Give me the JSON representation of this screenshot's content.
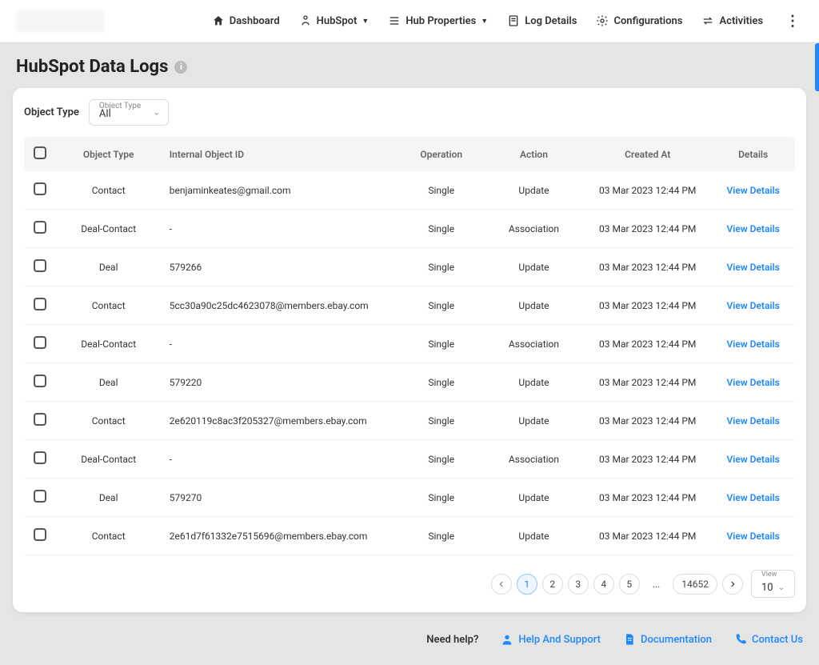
{
  "nav": {
    "dashboard": "Dashboard",
    "hubspot": "HubSpot",
    "hub_properties": "Hub Properties",
    "log_details": "Log Details",
    "configurations": "Configurations",
    "activities": "Activities"
  },
  "page_title": "HubSpot Data Logs",
  "filter": {
    "label": "Object Type",
    "float_label": "Object Type",
    "value": "All"
  },
  "columns": {
    "object_type": "Object Type",
    "internal_id": "Internal Object ID",
    "operation": "Operation",
    "action": "Action",
    "created_at": "Created At",
    "details": "Details"
  },
  "view_details_label": "View Details",
  "rows": [
    {
      "object_type": "Contact",
      "internal_id": "benjaminkeates@gmail.com",
      "operation": "Single",
      "action": "Update",
      "created_at": "03 Mar 2023 12:44 PM"
    },
    {
      "object_type": "Deal-Contact",
      "internal_id": "-",
      "operation": "Single",
      "action": "Association",
      "created_at": "03 Mar 2023 12:44 PM"
    },
    {
      "object_type": "Deal",
      "internal_id": "579266",
      "operation": "Single",
      "action": "Update",
      "created_at": "03 Mar 2023 12:44 PM"
    },
    {
      "object_type": "Contact",
      "internal_id": "5cc30a90c25dc4623078@members.ebay.com",
      "operation": "Single",
      "action": "Update",
      "created_at": "03 Mar 2023 12:44 PM"
    },
    {
      "object_type": "Deal-Contact",
      "internal_id": "-",
      "operation": "Single",
      "action": "Association",
      "created_at": "03 Mar 2023 12:44 PM"
    },
    {
      "object_type": "Deal",
      "internal_id": "579220",
      "operation": "Single",
      "action": "Update",
      "created_at": "03 Mar 2023 12:44 PM"
    },
    {
      "object_type": "Contact",
      "internal_id": "2e620119c8ac3f205327@members.ebay.com",
      "operation": "Single",
      "action": "Update",
      "created_at": "03 Mar 2023 12:44 PM"
    },
    {
      "object_type": "Deal-Contact",
      "internal_id": "-",
      "operation": "Single",
      "action": "Association",
      "created_at": "03 Mar 2023 12:44 PM"
    },
    {
      "object_type": "Deal",
      "internal_id": "579270",
      "operation": "Single",
      "action": "Update",
      "created_at": "03 Mar 2023 12:44 PM"
    },
    {
      "object_type": "Contact",
      "internal_id": "2e61d7f61332e7515696@members.ebay.com",
      "operation": "Single",
      "action": "Update",
      "created_at": "03 Mar 2023 12:44 PM"
    }
  ],
  "pagination": {
    "pages": [
      "1",
      "2",
      "3",
      "4",
      "5",
      "...",
      "14652"
    ],
    "active": "1",
    "view_label": "View",
    "view_value": "10"
  },
  "footer": {
    "need_help": "Need help?",
    "help_support": "Help And Support",
    "documentation": "Documentation",
    "contact_us": "Contact Us"
  }
}
